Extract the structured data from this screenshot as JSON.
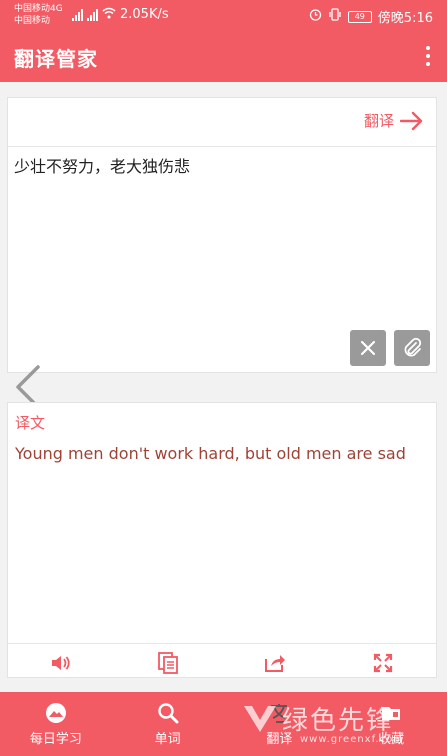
{
  "status_bar": {
    "carrier_1": "中国移动4G",
    "carrier_2": "中国移动",
    "speed": "2.05K/s",
    "battery": "49",
    "time": "傍晚5:16"
  },
  "app_bar": {
    "title": "翻译管家",
    "menu_icon": "more-vertical-icon"
  },
  "input_card": {
    "translate_label": "翻译",
    "input_value": "少壮不努力，老大独伤悲",
    "clear_icon": "close-icon",
    "attach_icon": "paperclip-icon"
  },
  "output_card": {
    "label": "译文",
    "text": "Young men don't work hard, but old men are sad",
    "tools": [
      "speaker-icon",
      "copy-icon",
      "share-icon",
      "fullscreen-icon"
    ]
  },
  "bottom_nav": {
    "items": [
      {
        "label": "每日学习",
        "icon": "landscape-icon"
      },
      {
        "label": "单词",
        "icon": "search-icon"
      },
      {
        "label": "翻译",
        "icon": "translate-icon"
      },
      {
        "label": "收藏",
        "icon": "folder-icon"
      }
    ]
  },
  "watermark": {
    "text": "绿色先锋",
    "url": "www.greenxf.com"
  },
  "colors": {
    "brand": "#f25a64",
    "output_text": "#a04236",
    "button_gray": "#9a9a9a"
  }
}
